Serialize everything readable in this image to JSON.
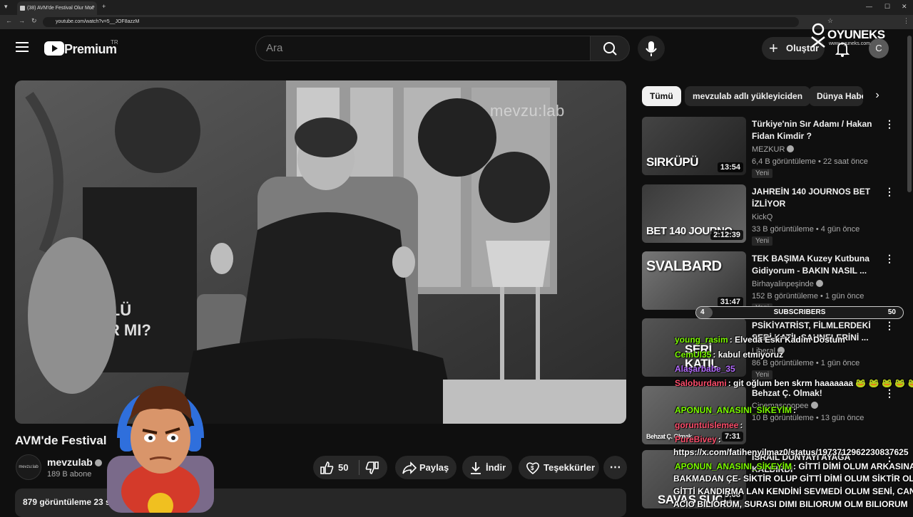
{
  "browser": {
    "tab_title": "(38) AVM'de Festival Olur Mu?",
    "url": "youtube.com/watch?v=5__JOF8azzM"
  },
  "header": {
    "brand": "Premium",
    "brand_region": "TR",
    "search_placeholder": "Ara",
    "create_label": "Oluştur",
    "avatar_initial": "C"
  },
  "overlay": {
    "logo_text": "OYUNEKS",
    "logo_sub": "www.oyuneks.com",
    "video_watermark": "mevzu:lab"
  },
  "chips": [
    {
      "label": "Tümü",
      "active": true
    },
    {
      "label": "mevzulab adlı yükleyiciden",
      "active": false
    },
    {
      "label": "Dünya Habe",
      "active": false
    }
  ],
  "recommendations": [
    {
      "title": "Türkiye'nin Sır Adamı / Hakan Fidan Kimdir ?",
      "channel": "MEZKUR",
      "meta": "6,4 B görüntüleme • 22 saat önce",
      "badge": "Yeni",
      "duration": "13:54",
      "thumb_text": "SIRKÜPÜ"
    },
    {
      "title": "JAHREİN 140 JOURNOS BET İZLİYOR",
      "channel": "KickQ",
      "meta": "33 B görüntüleme • 4 gün önce",
      "badge": "Yeni",
      "duration": "2:12:39",
      "thumb_text": "BET 140 JOURNO"
    },
    {
      "title": "TEK BAŞIMA Kuzey Kutbuna Gidiyorum - BAKIN NASIL ...",
      "channel": "Birhayalinpeşinde",
      "meta": "152 B görüntüleme • 1 gün önce",
      "badge": "Yeni",
      "duration": "31:47",
      "thumb_text": "SVALBARD"
    },
    {
      "title": "PSİKİYATRİST, FİLMLERDEKİ SERİ KATİL SAHNELERİNİ ...",
      "channel": "Liberal",
      "meta": "86 B görüntüleme • 1 gün önce",
      "badge": "Yeni",
      "duration": "",
      "thumb_text": "SERİ KATİL"
    },
    {
      "title": "Behzat Ç. Olmak!",
      "channel": "Cinemascoopee",
      "meta": "10 B görüntüleme • 13 gün önce",
      "badge": "",
      "duration": "7:31",
      "thumb_text": "Behzat Ç. Olmak"
    },
    {
      "title": "İSRAİL DÜNYAYI AYAĞA KALDIRDI",
      "channel": "",
      "meta": "",
      "badge": "",
      "duration": "9:08",
      "thumb_text": "SAVAŞ SUÇU"
    }
  ],
  "subscribers_bar": {
    "label": "SUBSCRIBERS",
    "current": "4",
    "goal": "50",
    "progress": 0.08
  },
  "chat": [
    {
      "user": "young_rasim",
      "color": "#7CFC00",
      "text": ": Elveda Eski Kadım Dostum"
    },
    {
      "user": "CemUl35",
      "color": "#7CFC00",
      "text": ": kabul etmiyoruz"
    },
    {
      "user": "Alaşarbabe_35",
      "color": "#b46bff",
      "text": ""
    },
    {
      "user": "Saloburdami",
      "color": "#ff4f6d",
      "text": ": git oğlum ben skrm haaaaaaa 🐸 🐸 🐸 🐸 🐸 🐸 🐸"
    },
    {
      "user": "APONUN_ANASINI_SİKEYİM",
      "color": "#7CFC00",
      "text": ":"
    },
    {
      "user": "goruntuislemee",
      "color": "#ff4f6d",
      "text": ":"
    },
    {
      "user": "PureBivey",
      "color": "#ff4f6d",
      "text": ":"
    },
    {
      "user": "",
      "color": "#ffffff",
      "text": "https://x.com/fatihenyilmaz0/status/1973712962230837625"
    },
    {
      "user": "APONUN_ANASINI_SİKEYİM",
      "color": "#7CFC00",
      "text": ": GİTTİ DİMİ OLUM ARKASINA"
    },
    {
      "user": "",
      "color": "#ffffff",
      "text": "BAKMADAN ÇE- SİKTİR OLUP GİTTİ DİMİ OLUM SİKTİR OLUP"
    },
    {
      "user": "",
      "color": "#ffffff",
      "text": "GİTTİ KANDIRMA LAN KENDİNİ SEVMEDİ OLUM SENİ, CANIN"
    },
    {
      "user": "",
      "color": "#ffffff",
      "text": "ACIO BILIORUM, SURASI DIMI BILIORUM OLM BILIORUM"
    }
  ],
  "video": {
    "title": "AVM'de Festival",
    "channel_name": "mevzulab",
    "channel_avatar_text": "mevzu:lab",
    "channel_subs": "189 B abone",
    "likes": "50",
    "share_label": "Paylaş",
    "download_label": "İndir",
    "thanks_label": "Teşekkürler",
    "views_line": "879 görüntüleme  23 sa"
  }
}
